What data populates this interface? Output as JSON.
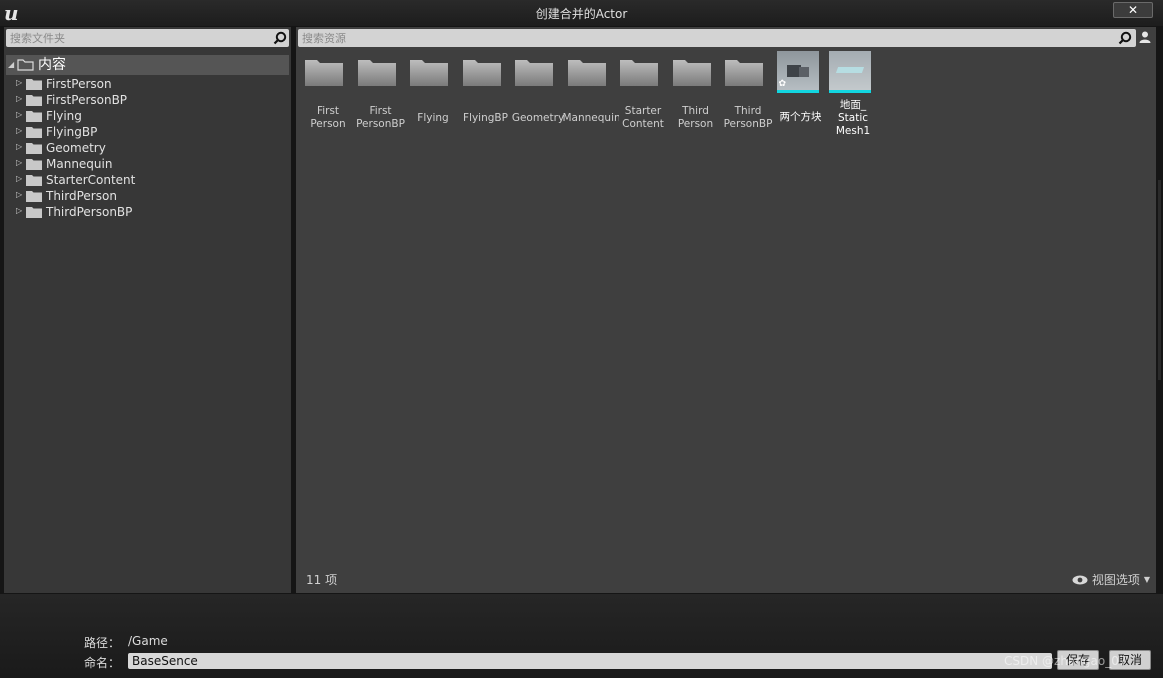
{
  "window": {
    "title": "创建合并的Actor",
    "close_label": "✕",
    "logo_icon": "unreal-logo-icon"
  },
  "folder_panel": {
    "search_placeholder": "搜索文件夹",
    "root_label": "内容",
    "items": [
      {
        "label": "FirstPerson"
      },
      {
        "label": "FirstPersonBP"
      },
      {
        "label": "Flying"
      },
      {
        "label": "FlyingBP"
      },
      {
        "label": "Geometry"
      },
      {
        "label": "Mannequin"
      },
      {
        "label": "StarterContent"
      },
      {
        "label": "ThirdPerson"
      },
      {
        "label": "ThirdPersonBP"
      }
    ]
  },
  "asset_panel": {
    "search_placeholder": "搜索资源",
    "assets": [
      {
        "label": "First\nPerson",
        "kind": "folder"
      },
      {
        "label": "First\nPersonBP",
        "kind": "folder"
      },
      {
        "label": "Flying",
        "kind": "folder"
      },
      {
        "label": "FlyingBP",
        "kind": "folder"
      },
      {
        "label": "Geometry",
        "kind": "folder"
      },
      {
        "label": "Mannequin",
        "kind": "folder"
      },
      {
        "label": "Starter\nContent",
        "kind": "folder"
      },
      {
        "label": "Third\nPerson",
        "kind": "folder"
      },
      {
        "label": "Third\nPersonBP",
        "kind": "folder"
      },
      {
        "label": "两个方块",
        "kind": "level"
      },
      {
        "label": "地面_\nStatic\nMesh1",
        "kind": "static-mesh"
      }
    ],
    "item_count": "11 项",
    "view_options_label": "视图选项"
  },
  "footer": {
    "path_label": "路径：",
    "path_value": "/Game",
    "name_label": "命名：",
    "name_value": "BaseSence",
    "save_label": "保存",
    "cancel_label": "取消",
    "watermark": "CSDN @zhangao_07"
  },
  "colors": {
    "accent_cyan": "#12d6e0",
    "panel_bg": "#3f3f3f",
    "tree_bg": "#373737",
    "selected_row": "#555555"
  }
}
